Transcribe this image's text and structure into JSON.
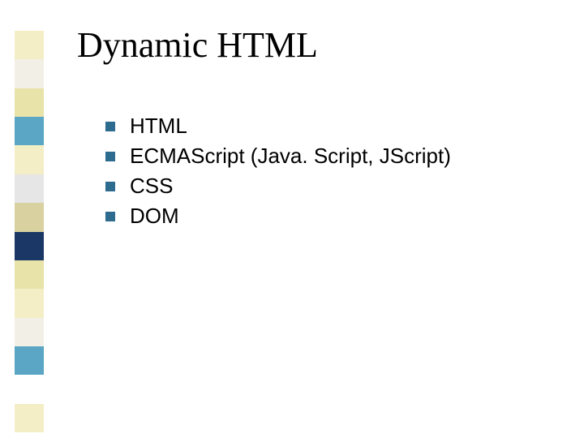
{
  "title": "Dynamic HTML",
  "items": [
    {
      "label": "HTML"
    },
    {
      "label": "ECMAScript (Java. Script, JScript)"
    },
    {
      "label": "CSS"
    },
    {
      "label": "DOM"
    }
  ],
  "sidebar_colors": [
    "#f4eec7",
    "#f2efe6",
    "#e8e3a8",
    "#5aa6c4",
    "#f4eec7",
    "#e6e6e6",
    "#d9d2a0",
    "#1a3766",
    "#e8e3a8",
    "#f4eec7",
    "#f2efe6",
    "#5aa6c4",
    "#ffffff",
    "#f4eec7"
  ]
}
